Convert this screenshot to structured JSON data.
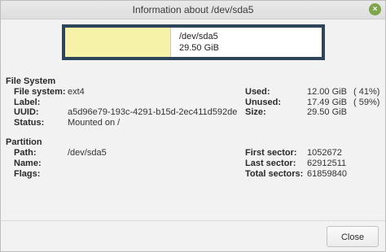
{
  "window": {
    "title": "Information about /dev/sda5"
  },
  "usage_graph": {
    "path": "/dev/sda5",
    "size": "29.50 GiB",
    "used_fraction": 0.41,
    "used_color": "#f6f3a8",
    "frame_color": "#2e4458"
  },
  "filesystem": {
    "heading": "File System",
    "filesystem_label": "File system:",
    "filesystem_value": "ext4",
    "label_label": "Label:",
    "label_value": "",
    "uuid_label": "UUID:",
    "uuid_value": "a5d96e79-193c-4291-b15d-2ec411d592de",
    "status_label": "Status:",
    "status_value": "Mounted on /",
    "used_label": "Used:",
    "used_value": "12.00 GiB",
    "used_percent": "( 41%)",
    "unused_label": "Unused:",
    "unused_value": "17.49 GiB",
    "unused_percent": "( 59%)",
    "size_label": "Size:",
    "size_value": "29.50 GiB"
  },
  "partition": {
    "heading": "Partition",
    "path_label": "Path:",
    "path_value": "/dev/sda5",
    "name_label": "Name:",
    "name_value": "",
    "flags_label": "Flags:",
    "flags_value": "",
    "first_sector_label": "First sector:",
    "first_sector_value": "1052672",
    "last_sector_label": "Last sector:",
    "last_sector_value": "62912511",
    "total_sectors_label": "Total sectors:",
    "total_sectors_value": "61859840"
  },
  "buttons": {
    "close_label": "Close",
    "titlebar_close_glyph": "×"
  }
}
